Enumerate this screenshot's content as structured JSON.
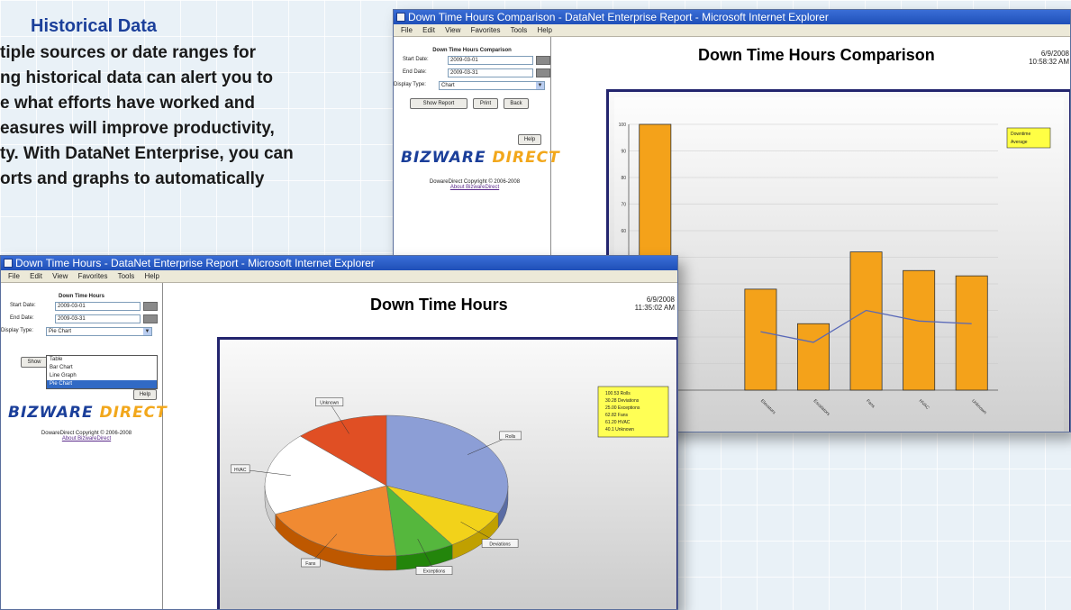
{
  "promo": {
    "heading": "Historical Data",
    "lines": [
      "tiple sources or date ranges for",
      "ng historical data can alert you to",
      "e what efforts have worked and",
      "easures will improve productivity,",
      "ty. With DataNet Enterprise, you can",
      "orts and graphs to automatically"
    ]
  },
  "back_window": {
    "title": "Down Time Hours Comparison - DataNet Enterprise Report - Microsoft Internet Explorer",
    "menu": [
      "File",
      "Edit",
      "View",
      "Favorites",
      "Tools",
      "Help"
    ],
    "sidebar": {
      "title": "Down Time Hours Comparison",
      "start_label": "Start Date:",
      "start_value": "2009-03-01",
      "end_label": "End Date:",
      "end_value": "2009-03-31",
      "display_label": "Display Type:",
      "display_value": "Chart",
      "show_button": "Show Report",
      "print_button": "Print",
      "back_button": "Back",
      "help_button": "Help",
      "logo_main": "BIZWARE",
      "logo_accent": "DIRECT",
      "copyright": "DowareDirect Copyright © 2006-2008",
      "about_link": "About BizwareDirect"
    },
    "report_title": "Down Time Hours Comparison",
    "date": "6/9/2008",
    "time": "10:58:32 AM",
    "legend": [
      "Downtime",
      "Average"
    ]
  },
  "front_window": {
    "title": "Down Time Hours - DataNet Enterprise Report - Microsoft Internet Explorer",
    "menu": [
      "File",
      "Edit",
      "View",
      "Favorites",
      "Tools",
      "Help"
    ],
    "sidebar": {
      "title": "Down Time Hours",
      "start_label": "Start Date:",
      "start_value": "2009-03-01",
      "end_label": "End Date:",
      "end_value": "2009-03-31",
      "display_label": "Display Type:",
      "display_value": "Pie Chart",
      "show_button": "Show",
      "dropdown_options": [
        "Table",
        "Bar Chart",
        "Line Graph",
        "Pie Chart"
      ],
      "help_button": "Help",
      "logo_main": "BIZWARE",
      "logo_accent": "DIRECT",
      "copyright": "DowareDirect Copyright © 2006-2008",
      "about_link": "About BizwareDirect"
    },
    "report_title": "Down Time Hours",
    "date": "6/9/2008",
    "time": "11:35:02 AM",
    "legend": [
      "100.53 Rolls",
      "30.28 Deviations",
      "25.00 Exceptions",
      "62.82 Fans",
      "61.20 HVAC",
      "40.1 Unknown"
    ]
  },
  "chart_data": [
    {
      "type": "bar",
      "categories": [
        "",
        "",
        "Elevators",
        "Escalators",
        "Fans",
        "HVAC",
        "Unknown"
      ],
      "values": [
        100,
        null,
        38,
        25,
        52,
        45,
        43
      ],
      "line_values": [
        null,
        null,
        22,
        18,
        30,
        26,
        25
      ],
      "ylim": [
        0,
        100
      ],
      "grid": true,
      "bar_color": "#f4a21a",
      "line_color": "#5868b8"
    },
    {
      "type": "pie",
      "labels": [
        "Rolls",
        "Deviations",
        "Exceptions",
        "Fans",
        "HVAC",
        "Unknown"
      ],
      "values": [
        100.53,
        30.28,
        25.0,
        62.82,
        61.2,
        40.1
      ],
      "colors": [
        "#8c9ed6",
        "#f2d21a",
        "#55b73d",
        "#f08a32",
        "#ffffff",
        "#e04f24"
      ]
    }
  ]
}
